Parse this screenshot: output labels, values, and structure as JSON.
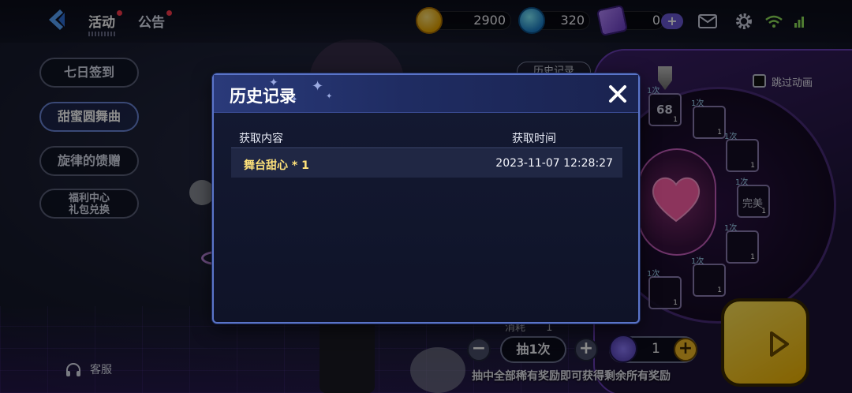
{
  "topbar": {
    "tabs": [
      {
        "label": "活动",
        "badge": true
      },
      {
        "label": "公告",
        "badge": true
      }
    ],
    "currencies": [
      {
        "icon": "music-coin-icon",
        "value": "2900"
      },
      {
        "icon": "globe-gem-icon",
        "value": "320"
      },
      {
        "icon": "ticket-icon",
        "value": "0"
      }
    ],
    "add_label": "+"
  },
  "left_menu": {
    "items": [
      {
        "label": "七日签到",
        "active": false
      },
      {
        "label": "甜蜜圆舞曲",
        "active": true
      },
      {
        "label": "旋律的馈赠",
        "active": false
      },
      {
        "label_line1": "福利中心",
        "label_line2": "礼包兑换",
        "active": false
      }
    ],
    "support_label": "客服"
  },
  "wheel": {
    "history_button": "历史记录",
    "skip_animation": "跳过动画",
    "slots": [
      {
        "label": "1次",
        "count": "1"
      },
      {
        "label": "1次",
        "count": "1"
      },
      {
        "label": "1次",
        "count": "1"
      },
      {
        "label": "1次",
        "count": "1"
      },
      {
        "label": "1次",
        "count": "1"
      },
      {
        "label": "1次",
        "count": "1"
      },
      {
        "label": "1次",
        "count": "1"
      }
    ],
    "slot_texts": [
      "68",
      "完美"
    ]
  },
  "controls": {
    "cost_label": "消耗",
    "cost_value": "1",
    "minus": "−",
    "draw_label": "抽1次",
    "plus": "+",
    "quantity": "1",
    "note": "抽中全部稀有奖励即可获得剩余所有奖励"
  },
  "modal": {
    "title": "历史记录",
    "columns": [
      "获取内容",
      "获取时间"
    ],
    "rows": [
      {
        "item": "舞台甜心 * 1",
        "time": "2023-11-07 12:28:27"
      }
    ]
  }
}
